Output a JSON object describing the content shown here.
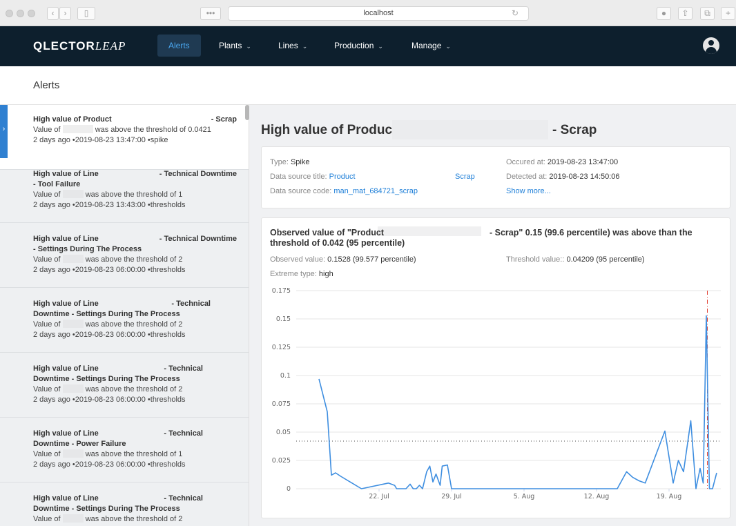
{
  "browser": {
    "url": "localhost"
  },
  "brand": {
    "strong": "QLECTOR",
    "light": "LEAP"
  },
  "nav": {
    "items": [
      {
        "label": "Alerts",
        "active": true,
        "dropdown": false
      },
      {
        "label": "Plants",
        "active": false,
        "dropdown": true
      },
      {
        "label": "Lines",
        "active": false,
        "dropdown": true
      },
      {
        "label": "Production",
        "active": false,
        "dropdown": true
      },
      {
        "label": "Manage",
        "active": false,
        "dropdown": true
      }
    ]
  },
  "page": {
    "title": "Alerts"
  },
  "alerts": [
    {
      "title_left": "High value of Product",
      "title_right": "- Scrap",
      "title_line2": "",
      "value_prefix": "Value of",
      "value_suffix": "was above the threshold of 0.0421",
      "meta": "2 days ago •2019-08-23 13:47:00 •spike",
      "selected": true
    },
    {
      "title_left": "High value of Line",
      "title_right": "- Technical Downtime",
      "title_line2": "- Tool Failure",
      "value_prefix": "Value of",
      "value_suffix": "was above the threshold of 1",
      "meta": "2 days ago •2019-08-23 13:43:00 •thresholds",
      "selected": false
    },
    {
      "title_left": "High value of Line",
      "title_right": "- Technical Downtime",
      "title_line2": "- Settings During The Process",
      "value_prefix": "Value of",
      "value_suffix": "was above the threshold of 2",
      "meta": "2 days ago •2019-08-23 06:00:00 •thresholds",
      "selected": false
    },
    {
      "title_left": "High value of Line",
      "title_right": "- Technical",
      "title_line2": "Downtime - Settings During The Process",
      "value_prefix": "Value of",
      "value_suffix": "was above the threshold of 2",
      "meta": "2 days ago •2019-08-23 06:00:00 •thresholds",
      "selected": false
    },
    {
      "title_left": "High value of Line",
      "title_right": "- Technical",
      "title_line2": "Downtime - Settings During The Process",
      "value_prefix": "Value of",
      "value_suffix": "was above the threshold of 2",
      "meta": "2 days ago •2019-08-23 06:00:00 •thresholds",
      "selected": false
    },
    {
      "title_left": "High value of Line",
      "title_right": "- Technical",
      "title_line2": "Downtime - Power Failure",
      "value_prefix": "Value of",
      "value_suffix": "was above the threshold of 1",
      "meta": "2 days ago •2019-08-23 06:00:00 •thresholds",
      "selected": false
    },
    {
      "title_left": "High value of Line",
      "title_right": "- Technical",
      "title_line2": "Downtime - Settings During The Process",
      "value_prefix": "Value of",
      "value_suffix": "was above the threshold of 2",
      "meta": "",
      "selected": false
    }
  ],
  "detail": {
    "title_left": "High value of Product",
    "title_right": "- Scrap",
    "type_label": "Type:",
    "type_value": "Spike",
    "ds_title_label": "Data source title:",
    "ds_title_value": "Product",
    "ds_title_suffix": "Scrap",
    "ds_code_label": "Data source code:",
    "ds_code_value": "man_mat_684721_scrap",
    "occured_label": "Occured at:",
    "occured_value": "2019-08-23 13:47:00",
    "detected_label": "Detected at:",
    "detected_value": "2019-08-23 14:50:06",
    "show_more": "Show more...",
    "obs_title_left": "Observed value of \"Product",
    "obs_title_right": "- Scrap\" 0.15 (99.6 percentile) was above than the",
    "obs_title_line2": "threshold of 0.042 (95 percentile)",
    "observed_label": "Observed value:",
    "observed_value": "0.1528 (99.577 percentile)",
    "threshold_label": "Threshold value::",
    "threshold_value": "0.04209 (95 percentile)",
    "extreme_label": "Extreme type:",
    "extreme_value": "high"
  },
  "chart_data": {
    "type": "line",
    "title": "",
    "xlabel": "",
    "ylabel": "",
    "ylim": [
      0,
      0.175
    ],
    "yticks": [
      "0",
      "0.025",
      "0.05",
      "0.075",
      "0.1",
      "0.125",
      "0.15",
      "0.175"
    ],
    "xticks": [
      "22. Jul",
      "29. Jul",
      "5. Aug",
      "12. Aug",
      "19. Aug"
    ],
    "xtick_days": [
      22,
      29,
      36,
      43,
      50
    ],
    "threshold": 0.04209,
    "alert_marker_day": 53.7,
    "grid": true,
    "legend": "none",
    "series": [
      {
        "color": "#3e8ee0",
        "points": [
          [
            16.2,
            0.097
          ],
          [
            17.0,
            0.068
          ],
          [
            17.4,
            0.012
          ],
          [
            17.8,
            0.014
          ],
          [
            18.3,
            0.011
          ],
          [
            20.3,
            0.0
          ],
          [
            22.9,
            0.005
          ],
          [
            23.5,
            0.003
          ],
          [
            23.7,
            0.0
          ],
          [
            24.6,
            0.0
          ],
          [
            25.0,
            0.004
          ],
          [
            25.3,
            0.0
          ],
          [
            25.6,
            0.0
          ],
          [
            25.9,
            0.003
          ],
          [
            26.2,
            0.0
          ],
          [
            26.6,
            0.015
          ],
          [
            26.9,
            0.02
          ],
          [
            27.2,
            0.006
          ],
          [
            27.5,
            0.013
          ],
          [
            27.9,
            0.003
          ],
          [
            28.1,
            0.02
          ],
          [
            28.6,
            0.021
          ],
          [
            29.0,
            0.0
          ],
          [
            45.0,
            0.0
          ],
          [
            45.9,
            0.015
          ],
          [
            46.5,
            0.01
          ],
          [
            47.1,
            0.007
          ],
          [
            47.7,
            0.005
          ],
          [
            49.6,
            0.051
          ],
          [
            50.4,
            0.005
          ],
          [
            50.9,
            0.025
          ],
          [
            51.4,
            0.015
          ],
          [
            52.1,
            0.06
          ],
          [
            52.6,
            0.0
          ],
          [
            53.0,
            0.018
          ],
          [
            53.3,
            0.005
          ],
          [
            53.6,
            0.1528
          ],
          [
            53.9,
            0.0
          ],
          [
            54.2,
            0.0
          ],
          [
            54.6,
            0.014
          ]
        ]
      }
    ]
  }
}
